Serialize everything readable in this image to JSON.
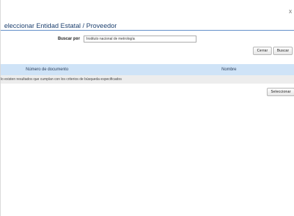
{
  "dialog": {
    "close_glyph": "x",
    "title": "eleccionar Entidad Estatal / Proveedor"
  },
  "search": {
    "label": "Buscar por",
    "value": "Instituto nacional de metrología"
  },
  "buttons": {
    "close": "Cerrar",
    "search": "Buscar",
    "select": "Seleccionar"
  },
  "table": {
    "columns": [
      "Número de documento",
      "Nombre"
    ],
    "empty_message": "lo existen resultados que cumplan con los criterios de búsqueda especificados"
  },
  "colors": {
    "title_text": "#1a3e6e",
    "title_rule": "#5b8ac7",
    "table_header_bg": "#cfe3f7",
    "empty_row_bg": "#ededed"
  },
  "icons": {
    "close": "close-icon"
  }
}
